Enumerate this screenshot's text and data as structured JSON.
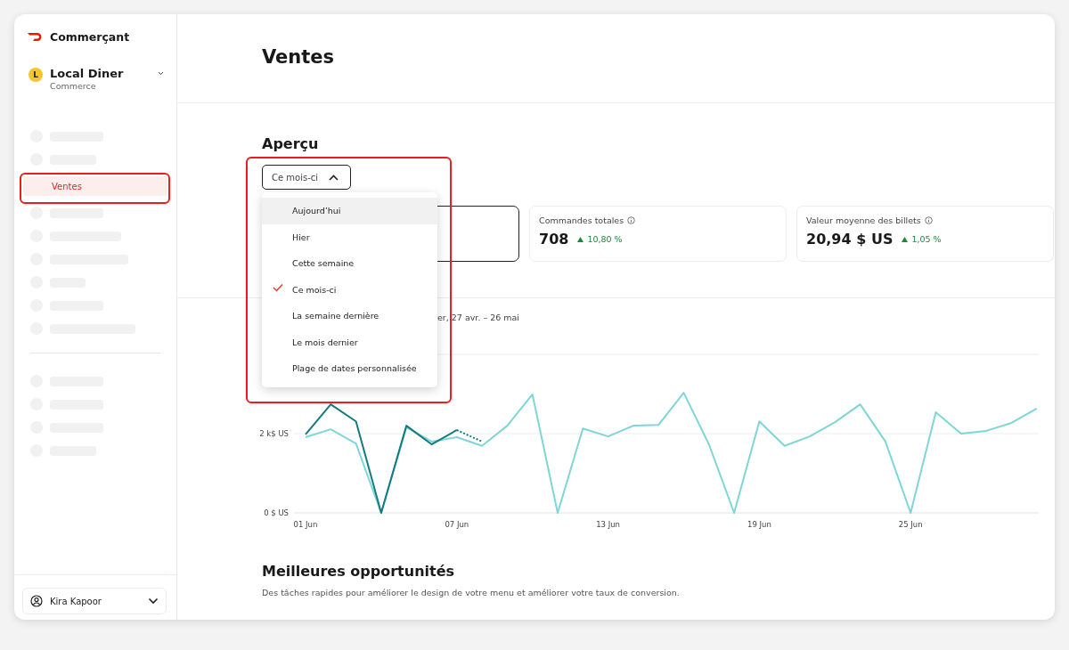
{
  "brand": {
    "name": "Commerçant"
  },
  "store": {
    "initial": "L",
    "name": "Local Diner",
    "type": "Commerce"
  },
  "sidebar": {
    "items": [
      {
        "kind": "skeleton"
      },
      {
        "kind": "skeleton"
      },
      {
        "kind": "link",
        "label": "Ventes",
        "selected": true
      },
      {
        "kind": "skeleton"
      },
      {
        "kind": "skeleton"
      },
      {
        "kind": "skeleton"
      },
      {
        "kind": "skeleton"
      },
      {
        "kind": "skeleton"
      },
      {
        "kind": "skeleton"
      },
      {
        "kind": "divider"
      },
      {
        "kind": "skeleton"
      },
      {
        "kind": "skeleton"
      },
      {
        "kind": "skeleton"
      },
      {
        "kind": "skeleton"
      }
    ],
    "user": {
      "name": "Kira Kapoor"
    }
  },
  "page": {
    "title": "Ventes"
  },
  "overview": {
    "title": "Aperçu",
    "period_button": {
      "label": "Ce mois-ci",
      "expanded": true
    },
    "menu": [
      {
        "label": "Aujourd’hui",
        "highlighted": true,
        "selected": false
      },
      {
        "label": "Hier",
        "highlighted": false,
        "selected": false
      },
      {
        "label": "Cette semaine",
        "highlighted": false,
        "selected": false
      },
      {
        "label": "Ce mois-ci",
        "highlighted": false,
        "selected": true
      },
      {
        "label": "La semaine dernière",
        "highlighted": false,
        "selected": false
      },
      {
        "label": "Le mois dernier",
        "highlighted": false,
        "selected": false
      },
      {
        "label": "Plage de dates personnalisée",
        "highlighted": false,
        "selected": false
      }
    ],
    "cards": [
      {
        "selected": true
      },
      {
        "selected": false,
        "label": "Commandes totales",
        "value": "708",
        "change": "10,80 %"
      },
      {
        "selected": false,
        "label": "Valeur moyenne des billets",
        "value": "20,94 $ US",
        "change": "1,05 %"
      }
    ],
    "comparison_text": "er, 27 avr. – 26 mai",
    "chart_data": {
      "type": "line",
      "categories": [
        "01 Jun",
        null,
        null,
        null,
        null,
        null,
        "07 Jun",
        null,
        null,
        null,
        null,
        null,
        "13 Jun",
        null,
        null,
        null,
        null,
        null,
        "19 Jun",
        null,
        null,
        null,
        null,
        null,
        "25 Jun",
        null,
        null,
        null,
        null,
        null
      ],
      "yticks": [
        {
          "value": 0,
          "label": "0 $ US"
        },
        {
          "value": 2000,
          "label": "2 k$ US"
        }
      ],
      "ylim": [
        0,
        4000
      ],
      "series": [
        {
          "color": "#7fd6d6",
          "values": [
            1910,
            2110,
            1750,
            0,
            2160,
            1800,
            1910,
            1690,
            2200,
            2990,
            0,
            2130,
            1930,
            2200,
            2220,
            3030,
            1730,
            0,
            2310,
            1690,
            1930,
            2290,
            2740,
            1800,
            0,
            2540,
            2000,
            2070,
            2270,
            2630
          ]
        },
        {
          "color": "#137b80",
          "values": [
            1980,
            2740,
            2310,
            0,
            2200,
            1730,
            2090,
            null,
            null,
            null,
            null,
            null,
            null,
            null,
            null,
            null,
            null,
            null,
            null,
            null,
            null,
            null,
            null,
            null,
            null,
            null,
            null,
            null,
            null,
            null
          ]
        },
        {
          "color": "#137b80",
          "line_style": "dotted",
          "values": [
            null,
            null,
            null,
            null,
            null,
            null,
            2090,
            1800,
            null,
            null,
            null,
            null,
            null,
            null,
            null,
            null,
            null,
            null,
            null,
            null,
            null,
            null,
            null,
            null,
            null,
            null,
            null,
            null,
            null,
            null
          ]
        }
      ]
    }
  },
  "opportunities": {
    "title": "Meilleures opportunités",
    "subtitle": "Des tâches rapides pour améliorer le design de votre menu et améliorer votre taux de conversion."
  }
}
